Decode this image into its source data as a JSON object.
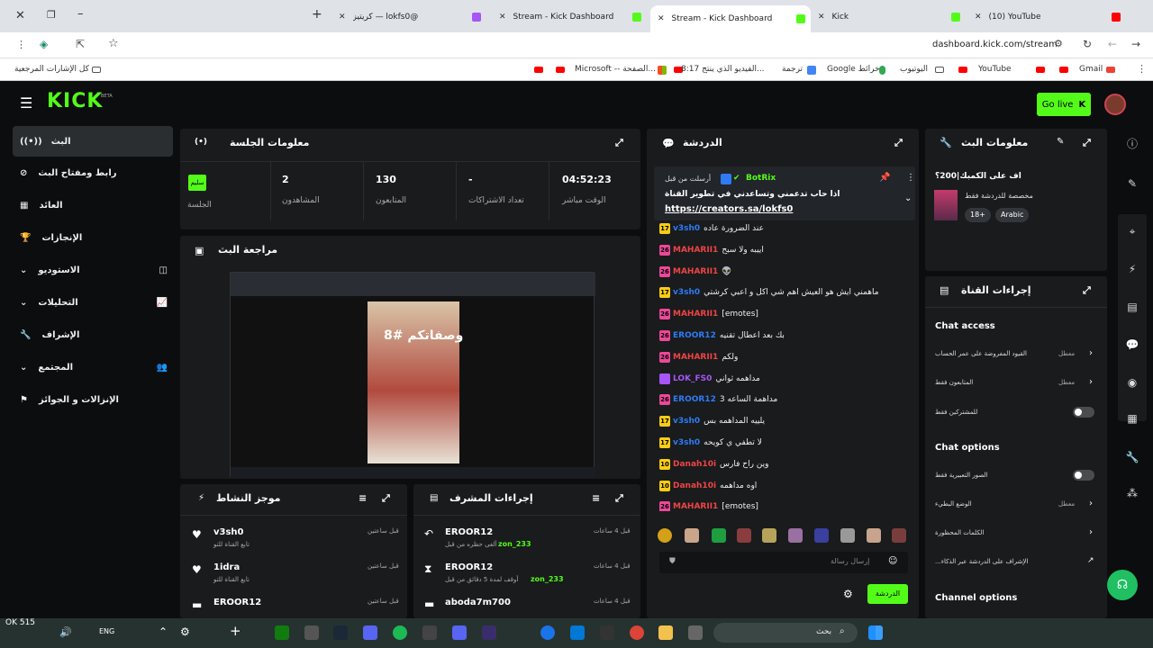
{
  "browser": {
    "tabs": [
      {
        "label": "كريتيز — lokfs0@",
        "color": "#a855f7"
      },
      {
        "label": "Stream - Kick Dashboard",
        "color": "#53fc18"
      },
      {
        "label": "Stream - Kick Dashboard",
        "color": "#53fc18"
      },
      {
        "label": "Kick",
        "color": "#53fc18"
      },
      {
        "label": "(10) YouTube",
        "color": "#ff0000"
      }
    ],
    "url": "dashboard.kick.com/stream",
    "bookmarks": [
      "كل الإشارات المرجعية",
      "Microsoft -- الصفحة...",
      "8:17 الفيديو الذي ينتج...",
      "ترجمة",
      "Google خرائط",
      "اليوتيوب",
      "YouTube",
      "Gmail"
    ]
  },
  "kick": {
    "logo": "KICK",
    "logo_badge": "BETA",
    "go_live": "Go live",
    "sidebar": [
      {
        "label": "البث",
        "active": true
      },
      {
        "label": "رابط ومفتاح البث"
      },
      {
        "label": "العائد"
      },
      {
        "label": "الإنجازات"
      },
      {
        "label": "الاستوديو"
      },
      {
        "label": "التحليلات"
      },
      {
        "label": "الإشراف"
      },
      {
        "label": "المجتمع"
      },
      {
        "label": "الإنزالات و الجوائز"
      }
    ],
    "session": {
      "title": "معلومات الجلسة",
      "health": "سليم",
      "health_label": "الجلسة",
      "stats": [
        {
          "value": "2",
          "label": "المشاهدون"
        },
        {
          "value": "130",
          "label": "المتابعون"
        },
        {
          "value": "-",
          "label": "تعداد الاشتراكات"
        },
        {
          "value": "04:52:23",
          "label": "الوقت مباشر"
        }
      ]
    },
    "preview": {
      "title": "مراجعة البث",
      "overlay": "وصفاتكم #8"
    },
    "activity": {
      "title": "موجز النشاط",
      "items": [
        {
          "name": "v3sh0",
          "sub": "تابع القناة للتو",
          "time": "قبل ساعتين"
        },
        {
          "name": "1idra",
          "sub": "تابع القناة للتو",
          "time": "قبل ساعتين"
        },
        {
          "name": "EROOR12",
          "sub": "",
          "time": "قبل ساعتين"
        }
      ]
    },
    "modactions": {
      "title": "إجراءات المشرف",
      "items": [
        {
          "name": "EROOR12",
          "sub": "ألغى حظره من قبل",
          "target": "zon_233",
          "time": "قبل 4 ساعات"
        },
        {
          "name": "EROOR12",
          "sub": "أوقف لمدة 5 دقائق من قبل",
          "target": "zon_233",
          "time": "قبل 4 ساعات"
        },
        {
          "name": "aboda7m700",
          "sub": "",
          "target": "",
          "time": "قبل 4 ساعات"
        }
      ]
    },
    "chat": {
      "title": "الدردشة",
      "pinned_by": "أرسلت من قبل",
      "pinned_user": "BotRix",
      "pinned_text": "اذا حاب تدعمني وتساعدني في تطوير القناة",
      "pinned_link": "https://creators.sa/lokfs0",
      "cut_line": "عند الضرورة عاده",
      "messages": [
        {
          "badge": "17",
          "badge_color": "#facc15",
          "user": "v3sh0",
          "color": "#2f7bf5",
          "text": "عند الضرورة عاده"
        },
        {
          "badge": "26",
          "badge_color": "#ec4899",
          "user": "MAHARII1",
          "color": "#ef4444",
          "text": "اييبه ولا سبح"
        },
        {
          "badge": "26",
          "badge_color": "#ec4899",
          "user": "MAHARII1",
          "color": "#ef4444",
          "text": "👽"
        },
        {
          "badge": "17",
          "badge_color": "#facc15",
          "user": "v3sh0",
          "color": "#2f7bf5",
          "text": "ماهمني ايش هو العيش اهم شي اكل و اعبي كرشتي"
        },
        {
          "badge": "26",
          "badge_color": "#ec4899",
          "user": "MAHARII1",
          "color": "#ef4444",
          "text": "[emotes]"
        },
        {
          "badge": "26",
          "badge_color": "#ec4899",
          "user": "EROOR12",
          "color": "#2f7bf5",
          "text": "بك بعد اعطال تقنيه"
        },
        {
          "badge": "26",
          "badge_color": "#ec4899",
          "user": "MAHARII1",
          "color": "#ef4444",
          "text": "ولكم"
        },
        {
          "badge": "",
          "badge_color": "#a855f7",
          "user": "LOK_FS0",
          "color": "#a855f7",
          "text": "مداهمه ثواني"
        },
        {
          "badge": "26",
          "badge_color": "#ec4899",
          "user": "EROOR12",
          "color": "#2f7bf5",
          "text": "مداهمة الساعه 3"
        },
        {
          "badge": "17",
          "badge_color": "#facc15",
          "user": "v3sh0",
          "color": "#2f7bf5",
          "text": "يلييه المداهمه بس"
        },
        {
          "badge": "17",
          "badge_color": "#facc15",
          "user": "v3sh0",
          "color": "#2f7bf5",
          "text": "لا تطفي ي كويحه"
        },
        {
          "badge": "10",
          "badge_color": "#facc15",
          "user": "Danah10i",
          "color": "#ef4444",
          "text": "وين راح فارس"
        },
        {
          "badge": "10",
          "badge_color": "#facc15",
          "user": "Danah10i",
          "color": "#ef4444",
          "text": "اوه مداهمه"
        },
        {
          "badge": "26",
          "badge_color": "#ec4899",
          "user": "MAHARII1",
          "color": "#ef4444",
          "text": "[emotes]"
        }
      ],
      "input_placeholder": "إرسال رسالة",
      "send_label": "الدردشة"
    },
    "streaminfo": {
      "title": "معلومات البث",
      "stream_title": "اف على الكمبك|200؟",
      "category": "مخصصة للدردشة فقط",
      "tags": [
        "18+",
        "Arabic"
      ]
    },
    "channel": {
      "title": "إجراءات القناة",
      "chat_access": "Chat access",
      "rows1": [
        {
          "label": "القيود المفروضة على عمر الحساب",
          "value": "معطل"
        },
        {
          "label": "المتابعون فقط",
          "value": "معطل"
        },
        {
          "label": "للمشتركين فقط",
          "value": ""
        }
      ],
      "chat_options": "Chat options",
      "rows2": [
        {
          "label": "الصور التعبيرية فقط",
          "value": ""
        },
        {
          "label": "الوضع البطيء",
          "value": "معطل"
        },
        {
          "label": "الكلمات المحظورة",
          "value": ""
        },
        {
          "label": "...الإشراف على الدردشة عبر الذكاء",
          "value": ""
        }
      ],
      "channel_options": "Channel options"
    }
  },
  "taskbar": {
    "time": "OK 515",
    "search": "بحث",
    "lang": "ENG"
  }
}
